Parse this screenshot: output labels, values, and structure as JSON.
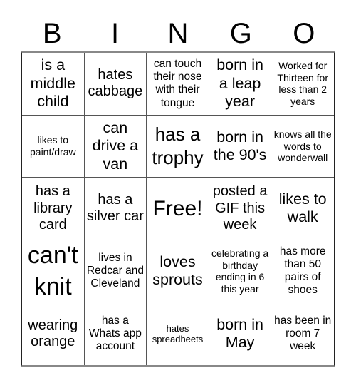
{
  "header": {
    "letters": [
      "B",
      "I",
      "N",
      "G",
      "O"
    ]
  },
  "cells": [
    "is a middle child",
    "hates cabbage",
    "can touch their nose with their tongue",
    "born in a leap year",
    "Worked for Thirteen for less than 2 years",
    "likes to paint/draw",
    "can drive a van",
    "has a trophy",
    "born in the 90's",
    "knows all the words to wonderwall",
    "has a library card",
    "has a silver car",
    "Free!",
    "posted a GIF this week",
    "likes to walk",
    "can't knit",
    "lives in Redcar and Cleveland",
    "loves sprouts",
    "celebrating a birthday ending in 6 this year",
    "has more than 50 pairs of shoes",
    "wearing orange",
    "has a Whats app account",
    "hates spreadheets",
    "born in May",
    "has been in room 7 week"
  ]
}
